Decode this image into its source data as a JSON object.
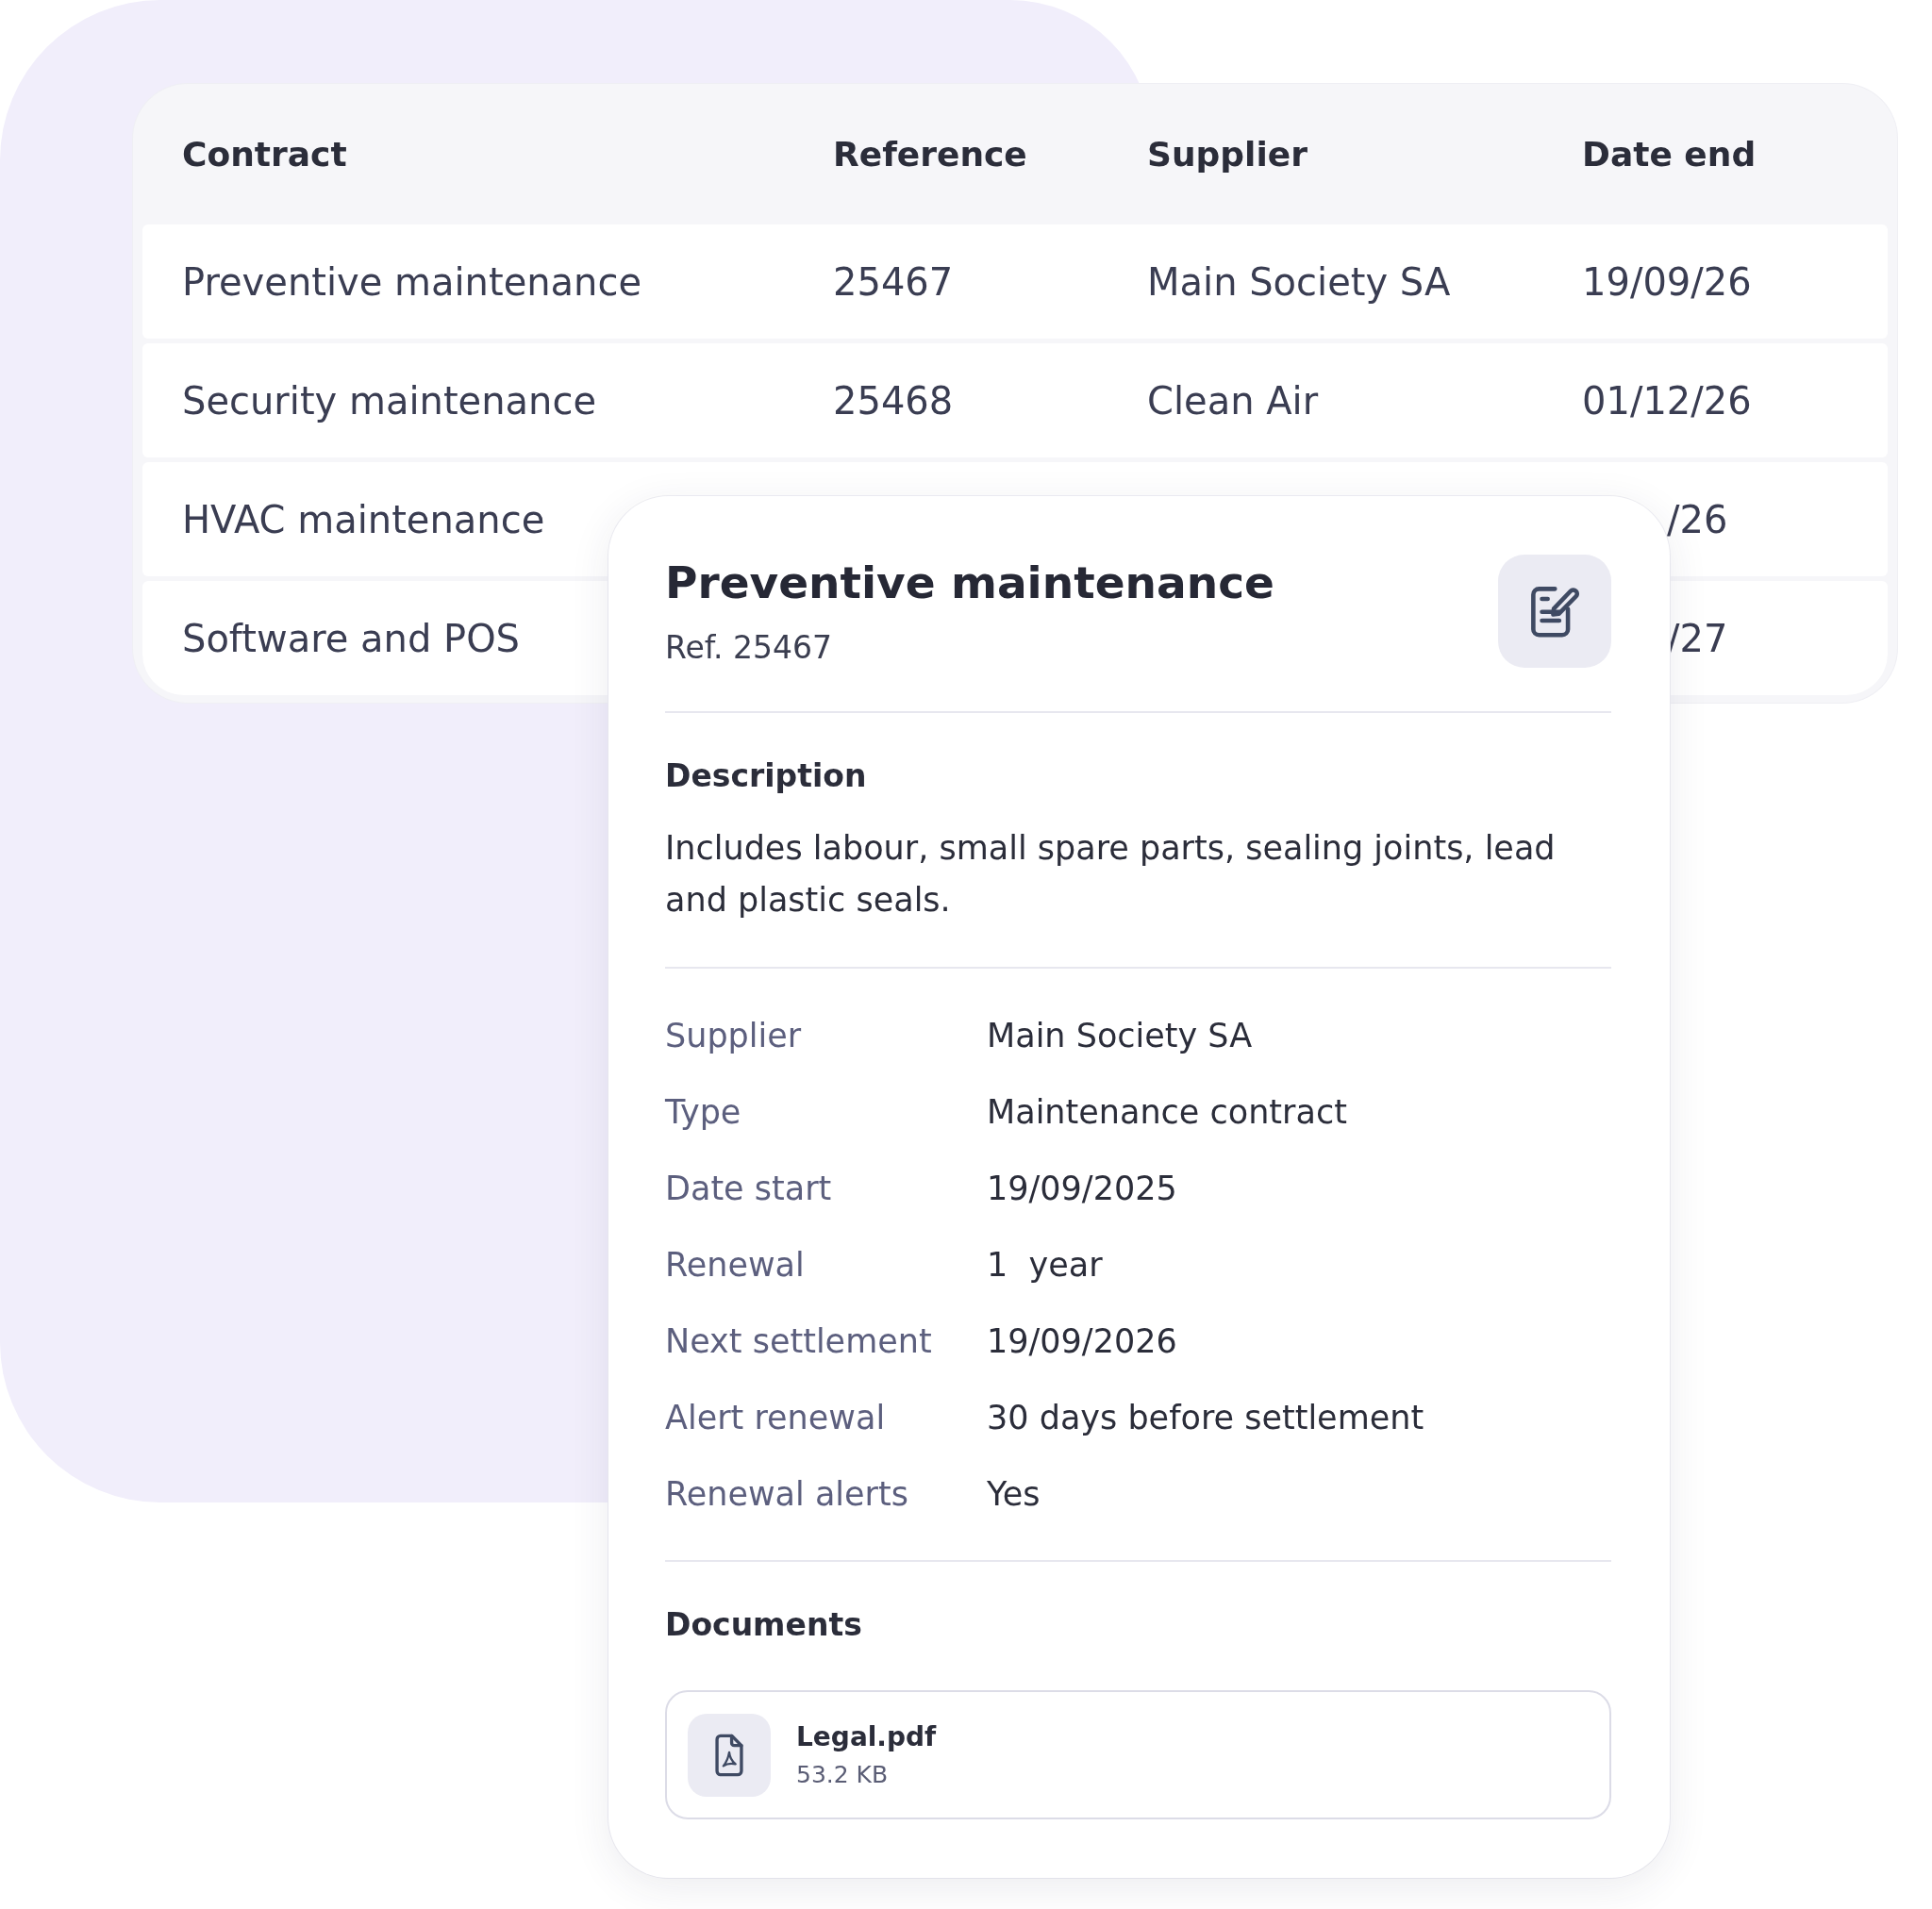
{
  "table": {
    "columns": [
      "Contract",
      "Reference",
      "Supplier",
      "Date end"
    ],
    "rows": [
      {
        "contract": "Preventive maintenance",
        "reference": "25467",
        "supplier": "Main Society SA",
        "date_end": "19/09/26"
      },
      {
        "contract": "Security maintenance",
        "reference": "25468",
        "supplier": "Clean Air",
        "date_end": "01/12/26"
      },
      {
        "contract": "HVAC maintenance",
        "date_end": "/26"
      },
      {
        "contract": "Software and POS",
        "date_end": "/27"
      }
    ]
  },
  "detail": {
    "title": "Preventive maintenance",
    "reference": "Ref. 25467",
    "description_heading": "Description",
    "description": "Includes labour, small spare parts, sealing joints, lead and plastic seals.",
    "fields": [
      {
        "label": "Supplier",
        "value": "Main Society SA"
      },
      {
        "label": "Type",
        "value": "Maintenance contract"
      },
      {
        "label": "Date start",
        "value": "19/09/2025"
      },
      {
        "label": "Renewal",
        "value": "1  year"
      },
      {
        "label": "Next settlement",
        "value": "19/09/2026"
      },
      {
        "label": "Alert renewal",
        "value": "30 days before settlement"
      },
      {
        "label": "Renewal alerts",
        "value": "Yes"
      }
    ],
    "documents_heading": "Documents",
    "documents": [
      {
        "name": "Legal.pdf",
        "size": "53.2 KB"
      }
    ]
  }
}
